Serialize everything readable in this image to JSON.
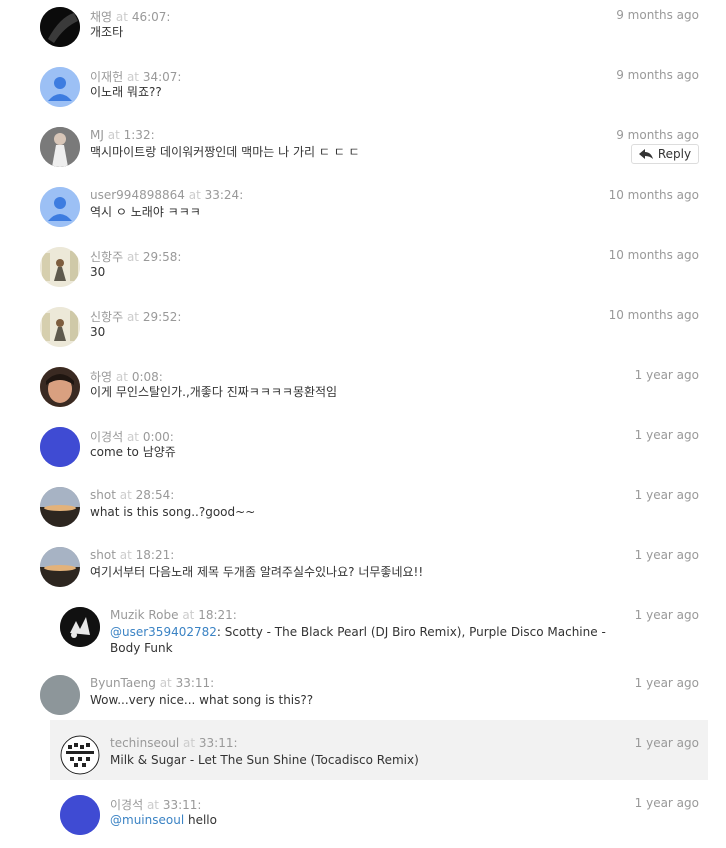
{
  "comments": [
    {
      "user": "채영",
      "at": "at",
      "time": "46:07:",
      "ago": "9 months ago",
      "text": "개조타",
      "avatar": "black-photo"
    },
    {
      "user": "이재헌",
      "at": "at",
      "time": "34:07:",
      "ago": "9 months ago",
      "text": "이노래 뭐죠??",
      "avatar": "default-user"
    },
    {
      "user": "MJ",
      "at": "at",
      "time": "1:32:",
      "ago": "9 months ago",
      "text": "맥시마이트랑 데이워커짱인데 맥마는 나 가리 ㄷ ㄷ ㄷ",
      "avatar": "person-photo",
      "reply_label": "Reply"
    },
    {
      "user": "user994898864",
      "at": "at",
      "time": "33:24:",
      "ago": "10 months ago",
      "text": "역시 ㅇ 노래야 ㅋㅋㅋ",
      "avatar": "default-user"
    },
    {
      "user": "신항주",
      "at": "at",
      "time": "29:58:",
      "ago": "10 months ago",
      "text": "30",
      "avatar": "room-photo"
    },
    {
      "user": "신항주",
      "at": "at",
      "time": "29:52:",
      "ago": "10 months ago",
      "text": "30",
      "avatar": "room-photo"
    },
    {
      "user": "하영",
      "at": "at",
      "time": "0:08:",
      "ago": "1 year ago",
      "text": "이게 무인스탈인가.,개좋다 진짜ㅋㅋㅋㅋ몽환적임",
      "avatar": "face-photo"
    },
    {
      "user": "이경석",
      "at": "at",
      "time": "0:00:",
      "ago": "1 year ago",
      "text": "come to 남양쥬",
      "avatar": "blue-circle"
    },
    {
      "user": "shot",
      "at": "at",
      "time": "28:54:",
      "ago": "1 year ago",
      "text": "what is this song..?good~~",
      "avatar": "sunset-photo"
    },
    {
      "user": "shot",
      "at": "at",
      "time": "18:21:",
      "ago": "1 year ago",
      "text": "여기서부터 다음노래 제목 두개좀 알려주실수있나요? 너무좋네요!!",
      "avatar": "sunset-photo"
    },
    {
      "user": "Muzik Robe",
      "at": "at",
      "time": "18:21:",
      "ago": "1 year ago",
      "mention": "@user359402782",
      "text_line1": ": Scotty - The Black Pearl (DJ Biro Remix), Purple Disco Machine -",
      "text_line2": "Body Funk",
      "avatar": "logo-photo"
    },
    {
      "user": "ByunTaeng",
      "at": "at",
      "time": "33:11:",
      "ago": "1 year ago",
      "text": "Wow...very nice... what song is this??",
      "avatar": "gray-circle"
    },
    {
      "user": "techinseoul",
      "at": "at",
      "time": "33:11:",
      "ago": "1 year ago",
      "text": "Milk & Sugar - Let The Sun Shine (Tocadisco Remix)",
      "avatar": "pattern-logo"
    },
    {
      "user": "이경석",
      "at": "at",
      "time": "33:11:",
      "ago": "1 year ago",
      "mention": "@muinseoul",
      "text": " hello",
      "avatar": "blue-circle"
    }
  ],
  "colors": {
    "mention": "#3b83c4",
    "meta": "#999999",
    "highlight_bg": "#f2f2f2",
    "blue_avatar": "#3f4bd3",
    "default_avatar": "#9cc0f5"
  }
}
